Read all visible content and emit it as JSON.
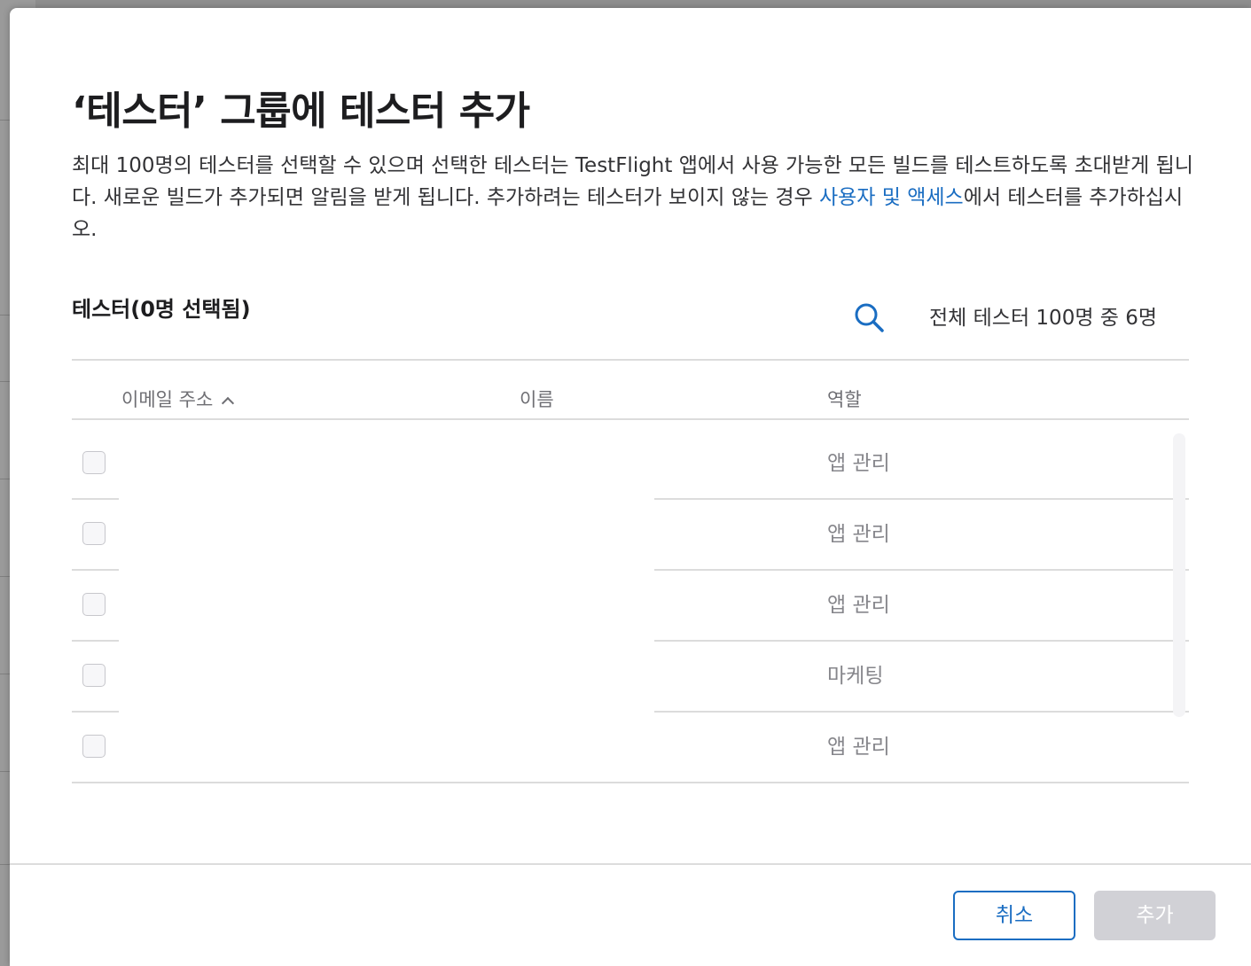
{
  "dialog": {
    "title": "‘테스터’ 그룹에 테스터 추가",
    "description_part1": "최대 100명의 테스터를 선택할 수 있으며 선택한 테스터는 TestFlight 앱에서 사용 가능한 모든 빌드를 테스트하도록 초대받게 됩니다. 새로운 빌드가 추가되면 알림을 받게 됩니다. 추가하려는 테스터가 보이지 않는 경우 ",
    "description_link": "사용자 및 액세스",
    "description_part2": "에서 테스터를 추가하십시오."
  },
  "testers": {
    "label": "테스터(0명 선택됨)",
    "count_text": "전체 테스터 100명 중 6명",
    "search_icon": "search-icon"
  },
  "table": {
    "columns": {
      "email": "이메일 주소",
      "name": "이름",
      "role": "역할"
    },
    "sort_indicator": "chevron-up-icon",
    "rows": [
      {
        "email": "",
        "name": "",
        "role": "앱 관리",
        "checked": false
      },
      {
        "email": "",
        "name": "",
        "role": "앱 관리",
        "checked": false
      },
      {
        "email": "",
        "name": "",
        "role": "앱 관리",
        "checked": false
      },
      {
        "email": "",
        "name": "",
        "role": "마케팅",
        "checked": false
      },
      {
        "email": "",
        "name": "",
        "role": "앱 관리",
        "checked": false
      }
    ]
  },
  "footer": {
    "cancel_label": "취소",
    "add_label": "추가"
  },
  "colors": {
    "accent": "#1a6dc2",
    "disabled_button": "#d1d1d6"
  }
}
